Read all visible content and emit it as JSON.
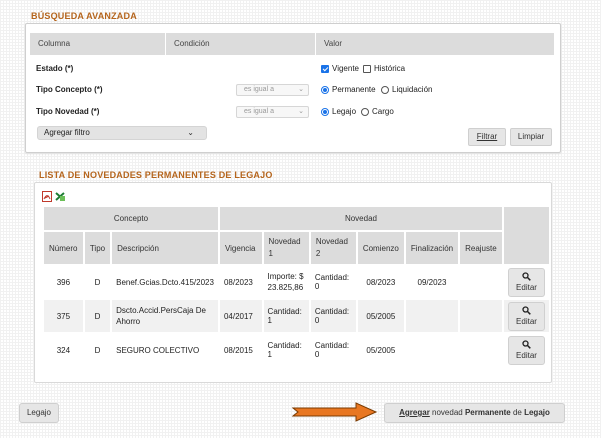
{
  "search": {
    "title": "BÚSQUEDA AVANZADA",
    "columns": {
      "column": "Columna",
      "condition": "Condición",
      "value": "Valor"
    },
    "rows": [
      {
        "label": "Estado (*)",
        "condition": "",
        "options": [
          "Vigente",
          "Histórica"
        ],
        "selected": [
          true,
          false
        ],
        "kind": "checkbox"
      },
      {
        "label": "Tipo Concepto (*)",
        "condition": "es igual a",
        "options": [
          "Permanente",
          "Liquidación"
        ],
        "selected": [
          true,
          false
        ],
        "kind": "radio"
      },
      {
        "label": "Tipo Novedad (*)",
        "condition": "es igual a",
        "options": [
          "Legajo",
          "Cargo"
        ],
        "selected": [
          true,
          false
        ],
        "kind": "radio"
      }
    ],
    "add_filter": "Agregar filtro",
    "filter_button": "Filtrar",
    "clear_button": "Limpiar"
  },
  "list": {
    "title": "LISTA DE NOVEDADES PERMANENTES DE LEGAJO",
    "group_headers": {
      "concept": "Concepto",
      "novelty": "Novedad"
    },
    "headers": [
      "Número",
      "Tipo",
      "Descripción",
      "Vigencia",
      "Novedad 1",
      "Novedad 2",
      "Comienzo",
      "Finalización",
      "Reajuste"
    ],
    "rows": [
      {
        "numero": "396",
        "tipo": "D",
        "descripcion": "Benef.Gcias.Dcto.415/2023",
        "vigencia": "08/2023",
        "novedad1": "Importe: $ 23.825,86",
        "novedad2": "Cantidad: 0",
        "comienzo": "08/2023",
        "finalizacion": "09/2023",
        "reajuste": ""
      },
      {
        "numero": "375",
        "tipo": "D",
        "descripcion": "Dscto.Accid.PersCaja De Ahorro",
        "vigencia": "04/2017",
        "novedad1": "Cantidad: 1",
        "novedad2": "Cantidad: 0",
        "comienzo": "05/2005",
        "finalizacion": "",
        "reajuste": ""
      },
      {
        "numero": "324",
        "tipo": "D",
        "descripcion": "SEGURO COLECTIVO",
        "vigencia": "08/2015",
        "novedad1": "Cantidad: 1",
        "novedad2": "Cantidad: 0",
        "comienzo": "05/2005",
        "finalizacion": "",
        "reajuste": ""
      }
    ],
    "edit_label": "Editar"
  },
  "footer": {
    "back_button": "Legajo",
    "add_button": {
      "part1": "Agregar",
      "part2": " novedad ",
      "part3": "Permanente",
      "part4": " de ",
      "part5": "Legajo"
    }
  },
  "icons": [
    "pdf-icon",
    "excel-icon",
    "search-icon",
    "arrow-right-icon",
    "chevron-down-icon"
  ],
  "colors": {
    "accent": "#b5651d",
    "arrow": "#e87722",
    "check": "#1a73e8"
  }
}
